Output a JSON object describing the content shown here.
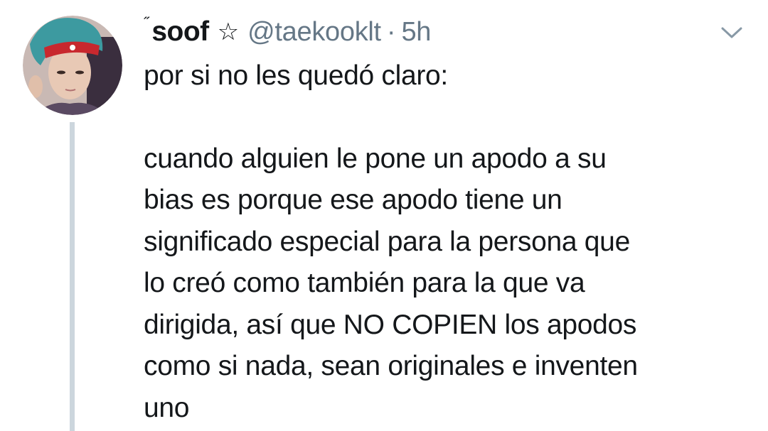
{
  "tweet": {
    "name_prefix_mark": "˝",
    "display_name": "soof",
    "name_emoji": "☆",
    "handle": "@taekooklt",
    "separator": "·",
    "time": "5h",
    "menu_icon": "chevron-down-icon",
    "intro_line": "por si no les quedó claro:",
    "body_lines": [
      "cuando alguien le pone un apodo a su",
      "bias es porque ese apodo tiene un",
      "significado especial para la persona que",
      "lo creó como también para la que va",
      "dirigida, así que NO COPIEN los apodos",
      "como si nada, sean originales e inventen",
      "uno"
    ]
  },
  "colors": {
    "text": "#14171a",
    "secondary": "#657786",
    "thread_line": "#ccd6dd"
  }
}
